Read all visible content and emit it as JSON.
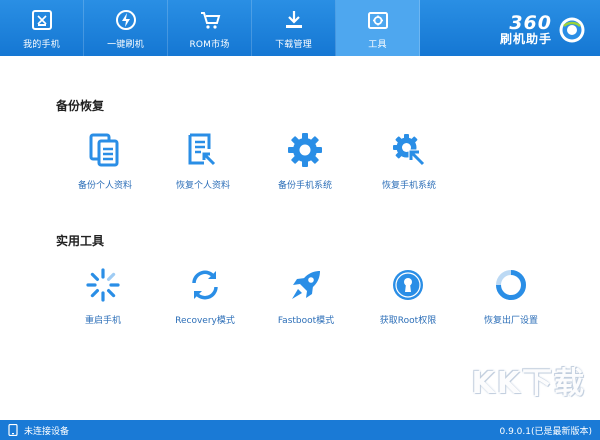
{
  "nav": {
    "tabs": [
      {
        "label": "我的手机",
        "icon": "phone-icon"
      },
      {
        "label": "一键刷机",
        "icon": "flash-icon"
      },
      {
        "label": "ROM市场",
        "icon": "cart-icon"
      },
      {
        "label": "下载管理",
        "icon": "download-icon"
      },
      {
        "label": "工具",
        "icon": "toolbox-icon",
        "active": true
      }
    ]
  },
  "brand": {
    "number": "360",
    "name": "刷机助手",
    "icon": "brand-logo-icon"
  },
  "backup": {
    "title": "备份恢复",
    "items": [
      {
        "label": "备份个人资料",
        "icon": "backup-data-icon"
      },
      {
        "label": "恢复个人资料",
        "icon": "restore-data-icon"
      },
      {
        "label": "备份手机系统",
        "icon": "backup-system-icon"
      },
      {
        "label": "恢复手机系统",
        "icon": "restore-system-icon"
      }
    ]
  },
  "utilities": {
    "title": "实用工具",
    "items": [
      {
        "label": "重启手机",
        "icon": "reboot-icon"
      },
      {
        "label": "Recovery模式",
        "icon": "recovery-icon"
      },
      {
        "label": "Fastboot模式",
        "icon": "rocket-icon"
      },
      {
        "label": "获取Root权限",
        "icon": "root-lock-icon"
      },
      {
        "label": "恢复出厂设置",
        "icon": "factory-reset-icon"
      }
    ]
  },
  "status": {
    "connection": "未连接设备",
    "version": "0.9.0.1(已是最新版本)"
  },
  "watermark": "KK下载",
  "colors": {
    "accent": "#1a7ad6",
    "icon_blue": "#2a8ee6",
    "label_blue": "#2d6fb8"
  }
}
